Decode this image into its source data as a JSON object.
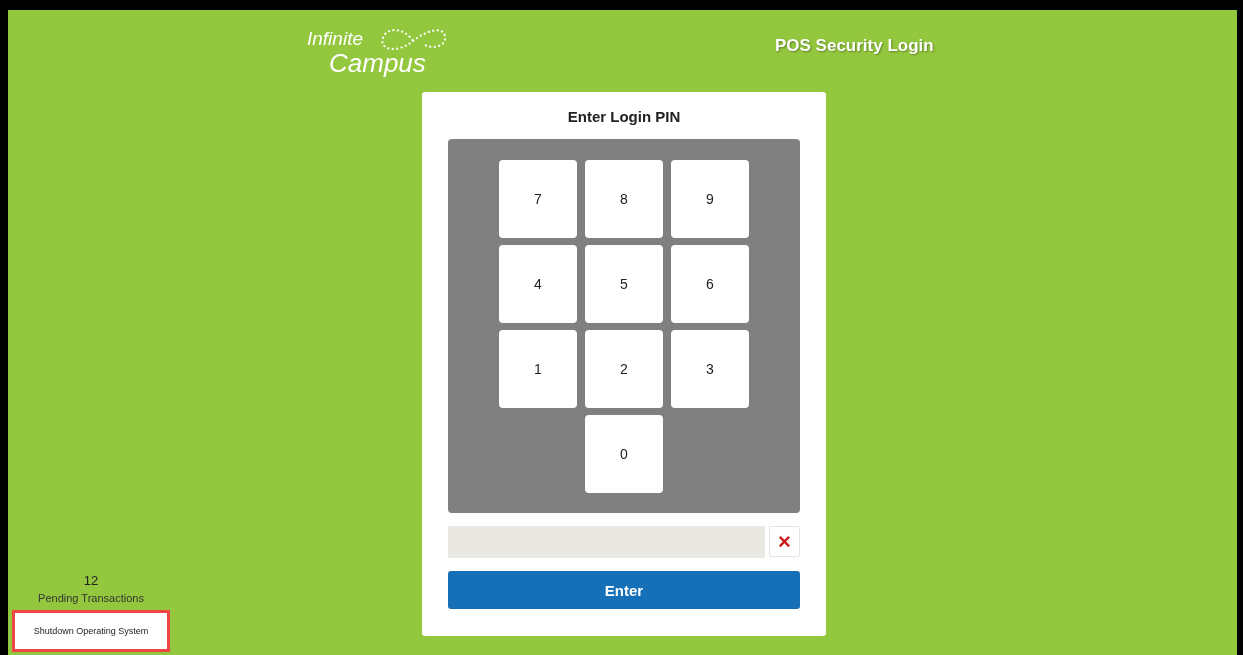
{
  "header": {
    "logo_lines": [
      "Infinite",
      "Campus"
    ],
    "title": "POS Security Login"
  },
  "login": {
    "title": "Enter Login PIN",
    "keypad_rows": [
      [
        "7",
        "8",
        "9"
      ],
      [
        "4",
        "5",
        "6"
      ],
      [
        "1",
        "2",
        "3"
      ],
      [
        "0"
      ]
    ],
    "clear_label": "×",
    "submit": "Enter"
  },
  "sidebar": {
    "pending_count": "12",
    "pending_label": "Pending Transactions",
    "shutdown": {
      "label": "Shutdown Operating System",
      "highlighted": true
    }
  }
}
